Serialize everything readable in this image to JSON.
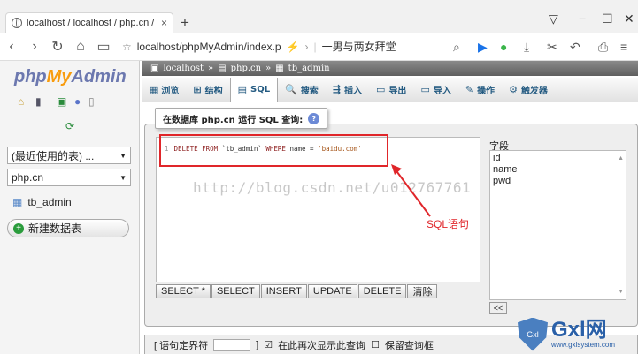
{
  "browser": {
    "tab_title": "localhost / localhost / php.cn / tb",
    "url": "localhost/phpMyAdmin/index.p",
    "search_text": "一男与两女拜堂"
  },
  "logo": {
    "php": "php",
    "my": "My",
    "admin": "Admin"
  },
  "left": {
    "recent_select": "(最近使用的表) ...",
    "db_select": "php.cn",
    "table_item": "tb_admin",
    "new_db": "新建数据表"
  },
  "breadcrumb": [
    "localhost",
    "php.cn",
    "tb_admin"
  ],
  "menu": [
    {
      "label": "浏览",
      "icon": "▦"
    },
    {
      "label": "结构",
      "icon": "⊞"
    },
    {
      "label": "SQL",
      "icon": "▤"
    },
    {
      "label": "搜索",
      "icon": "🔍"
    },
    {
      "label": "插入",
      "icon": "⇶"
    },
    {
      "label": "导出",
      "icon": "▭"
    },
    {
      "label": "导入",
      "icon": "▭"
    },
    {
      "label": "操作",
      "icon": "✎"
    },
    {
      "label": "触发器",
      "icon": "⚙"
    }
  ],
  "sql_panel": {
    "legend": "在数据库 php.cn 运行 SQL 查询:",
    "line_no": "1",
    "sql_kw1": "DELETE FROM",
    "sql_table": "`tb_admin`",
    "sql_kw2": "WHERE",
    "sql_cond": "name = ",
    "sql_str": "'baidu.com'",
    "watermark": "http://blog.csdn.net/u012767761",
    "annotation": "SQL语句",
    "buttons": [
      "SELECT *",
      "SELECT",
      "INSERT",
      "UPDATE",
      "DELETE",
      "清除"
    ]
  },
  "fields": {
    "label": "字段",
    "items": [
      "id",
      "name",
      "pwd"
    ],
    "insert_btn": "<<"
  },
  "bottom": {
    "delimiter_label": "[ 语句定界符",
    "close_bracket": "]",
    "checkbox1": "在此再次显示此查询",
    "checkbox2": "保留查询框"
  },
  "brand": {
    "name": "Gxl网",
    "url": "www.gxlsystem.com",
    "shield": "Gxl"
  }
}
